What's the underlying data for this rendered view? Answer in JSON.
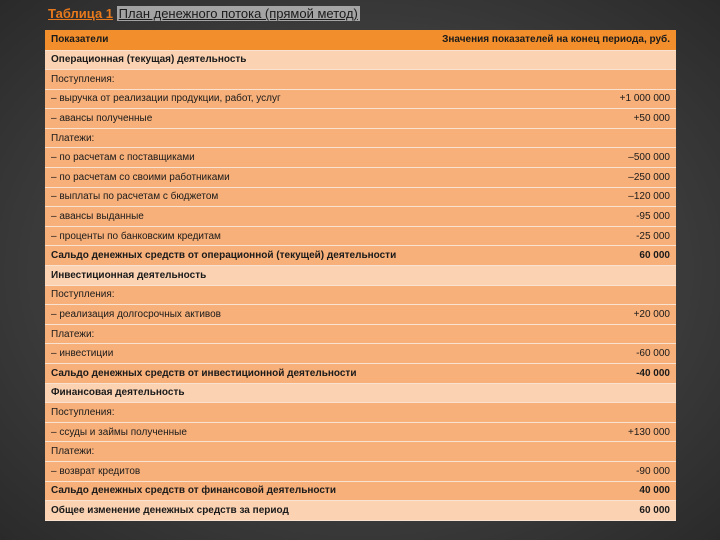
{
  "title": {
    "label": "Таблица 1",
    "text": "План денежного потока (прямой метод)"
  },
  "table": {
    "header": {
      "col1": "Показатели",
      "col2": "Значения показателей на конец периода, руб."
    },
    "rows": [
      {
        "label": "Операционная (текущая) деятельность",
        "value": "",
        "style": "light",
        "bold": true
      },
      {
        "label": "Поступления:",
        "value": "",
        "style": "orange",
        "bold": false
      },
      {
        "label": "– выручка от реализации продукции, работ, услуг",
        "value": "+1 000 000",
        "style": "orange",
        "bold": false
      },
      {
        "label": "– авансы полученные",
        "value": "+50 000",
        "style": "orange",
        "bold": false
      },
      {
        "label": "Платежи:",
        "value": "",
        "style": "orange",
        "bold": false
      },
      {
        "label": "– по расчетам с поставщиками",
        "value": "–500 000",
        "style": "orange",
        "bold": false
      },
      {
        "label": "– по расчетам со своими работниками",
        "value": "–250 000",
        "style": "orange",
        "bold": false
      },
      {
        "label": "– выплаты по расчетам с бюджетом",
        "value": "–120 000",
        "style": "orange",
        "bold": false
      },
      {
        "label": "– авансы выданные",
        "value": "-95 000",
        "style": "orange",
        "bold": false
      },
      {
        "label": "– проценты по банковским кредитам",
        "value": "-25 000",
        "style": "orange",
        "bold": false
      },
      {
        "label": "Сальдо денежных средств от операционной (текущей) деятельности",
        "value": "60 000",
        "style": "orange",
        "bold": true
      },
      {
        "label": "Инвестиционная деятельность",
        "value": "",
        "style": "light",
        "bold": true
      },
      {
        "label": "Поступления:",
        "value": "",
        "style": "orange",
        "bold": false
      },
      {
        "label": "– реализация долгосрочных активов",
        "value": "+20 000",
        "style": "orange",
        "bold": false
      },
      {
        "label": "Платежи:",
        "value": "",
        "style": "orange",
        "bold": false
      },
      {
        "label": "– инвестиции",
        "value": "-60 000",
        "style": "orange",
        "bold": false
      },
      {
        "label": "Сальдо денежных средств от инвестиционной деятельности",
        "value": "-40 000",
        "style": "orange",
        "bold": true
      },
      {
        "label": "Финансовая деятельность",
        "value": "",
        "style": "light",
        "bold": true
      },
      {
        "label": "Поступления:",
        "value": "",
        "style": "orange",
        "bold": false
      },
      {
        "label": "– ссуды и займы полученные",
        "value": "+130 000",
        "style": "orange",
        "bold": false
      },
      {
        "label": "Платежи:",
        "value": "",
        "style": "orange",
        "bold": false
      },
      {
        "label": "– возврат кредитов",
        "value": "-90 000",
        "style": "orange",
        "bold": false
      },
      {
        "label": "Сальдо денежных средств от финансовой деятельности",
        "value": "40 000",
        "style": "orange",
        "bold": true
      },
      {
        "label": "Общее изменение денежных средств за период",
        "value": "60 000",
        "style": "light",
        "bold": true
      }
    ]
  },
  "colors": {
    "header": "#f28e2b",
    "section_row": "#fbd3b3",
    "data_row": "#f7b07a",
    "title_label": "#e8791c"
  }
}
